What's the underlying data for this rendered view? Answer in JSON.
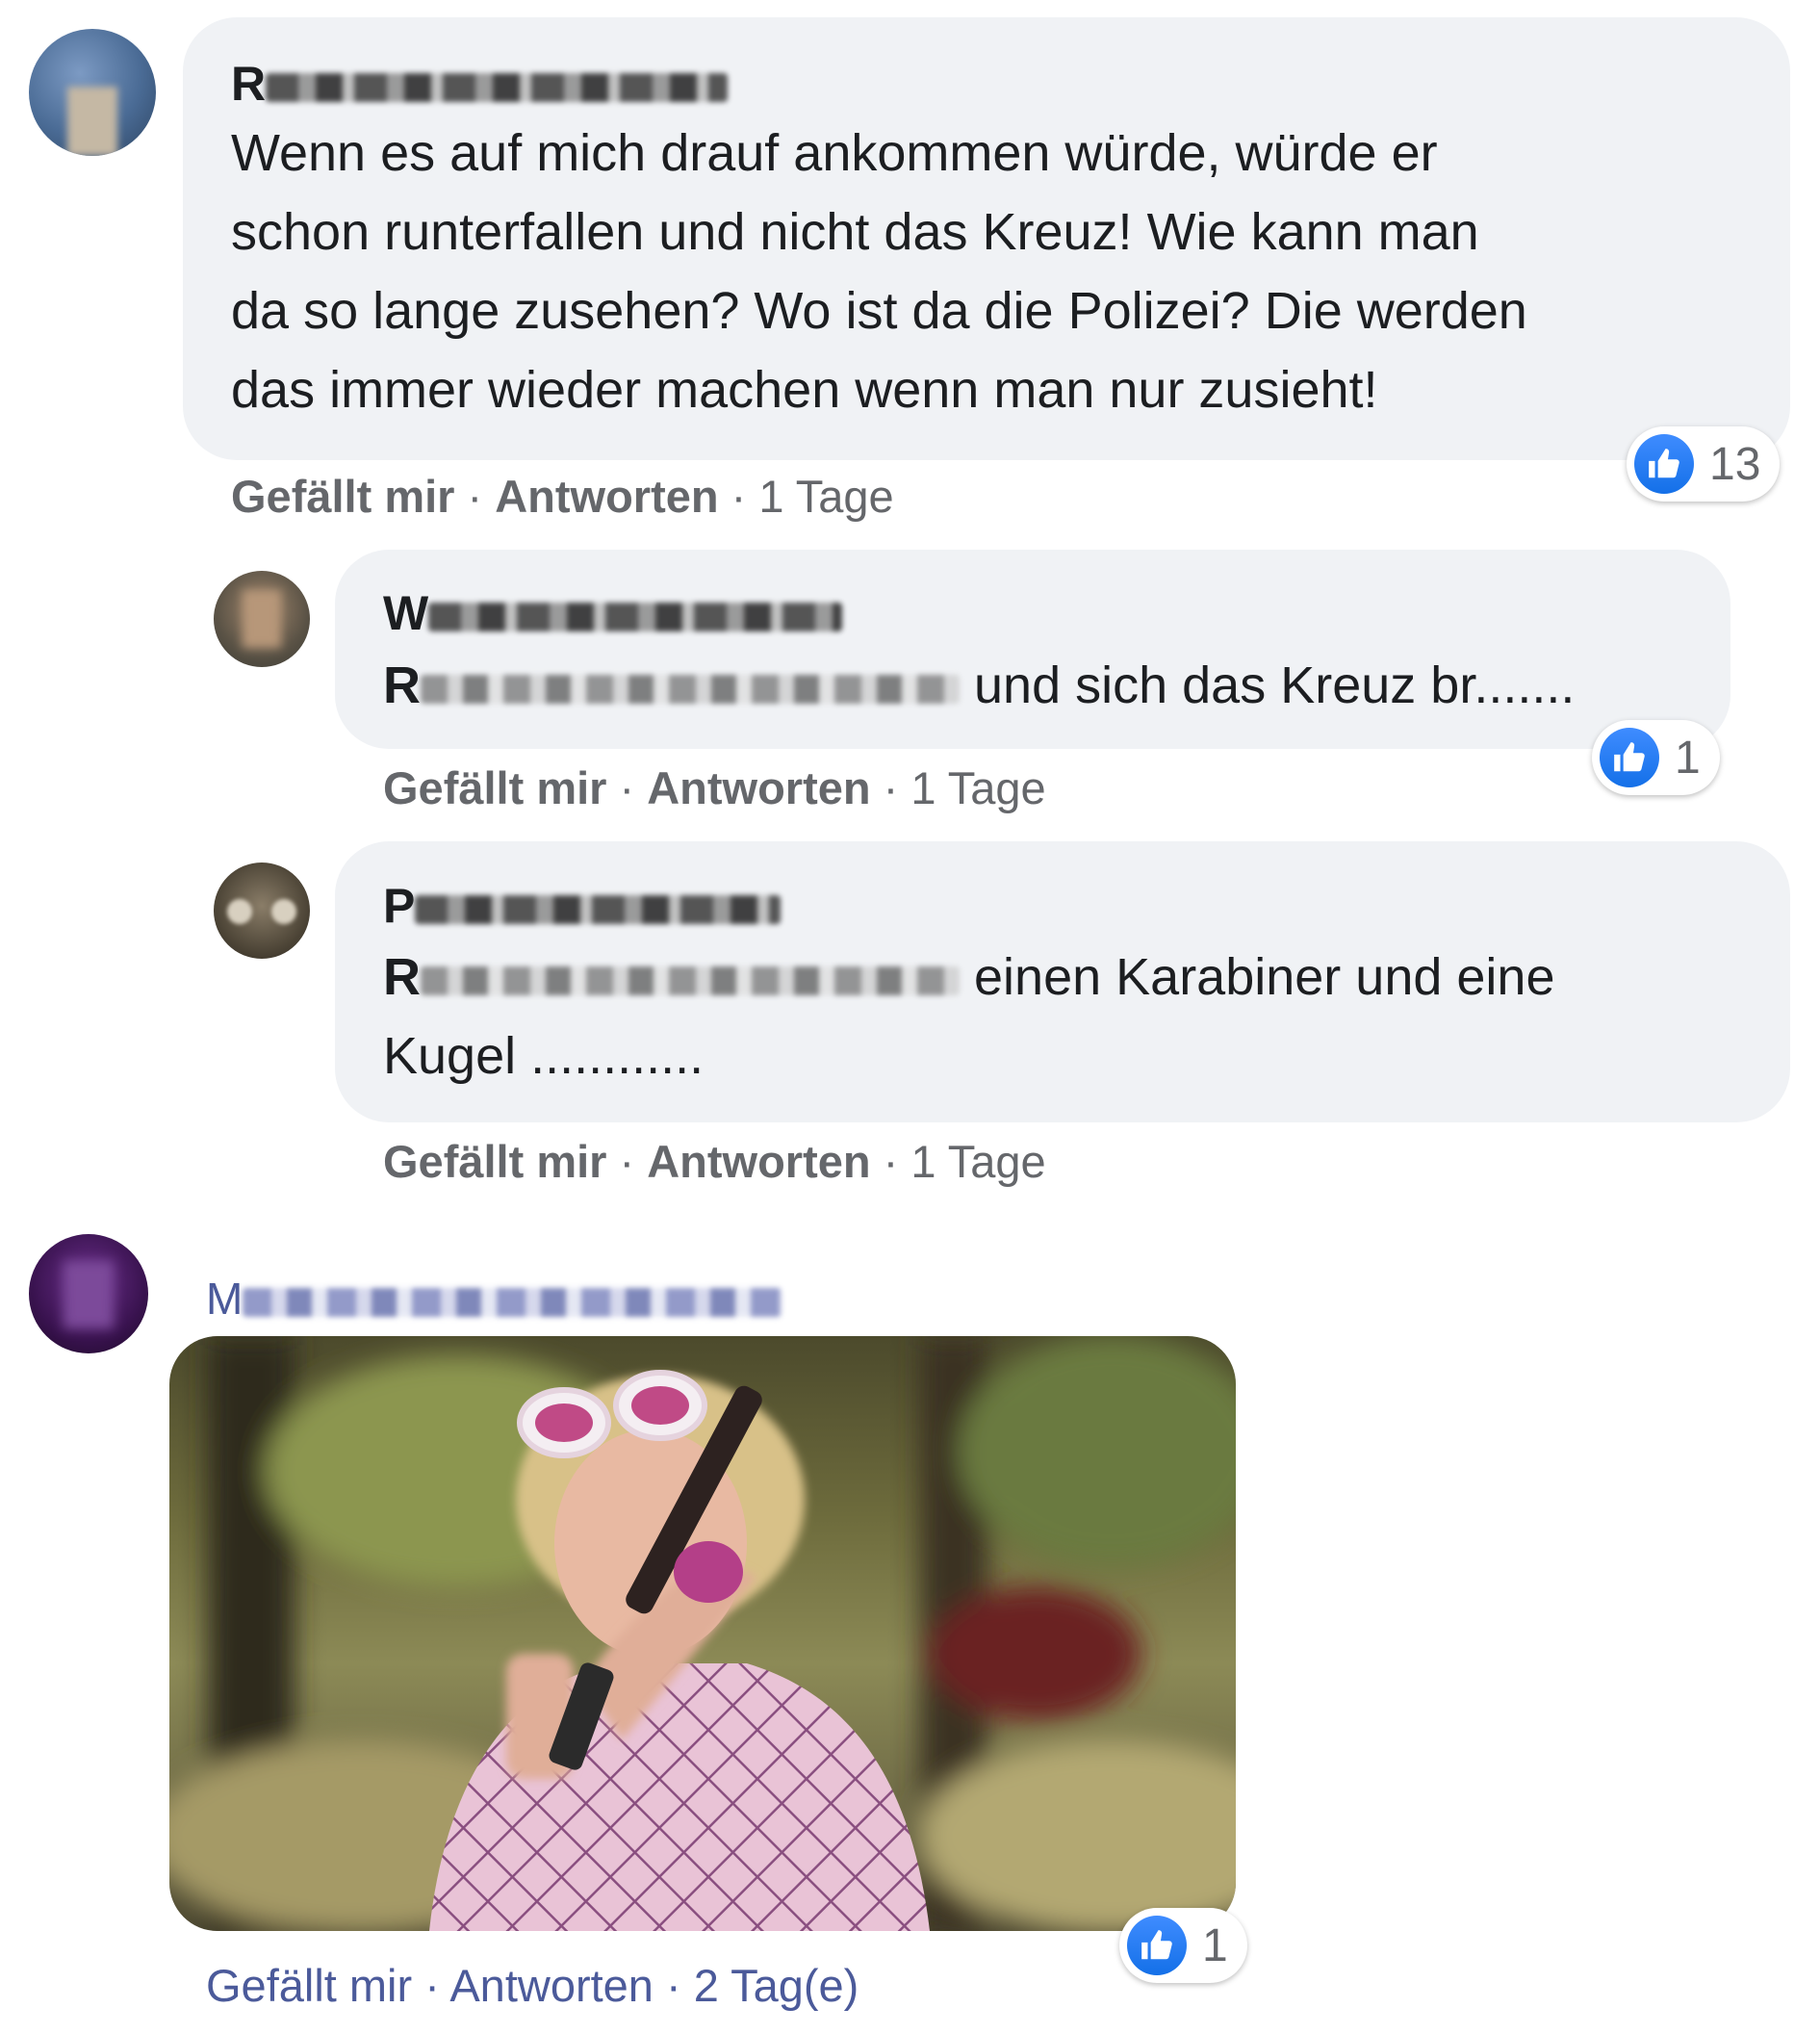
{
  "comments": [
    {
      "author": "R",
      "text": "Wenn es auf mich drauf ankommen würde, würde er schon runterfallen und nicht das Kreuz! Wie kann man da so lange zusehen? Wo ist da die Polizei? Die werden das immer wieder machen wenn man nur zusieht!",
      "lines": [
        "Wenn es auf mich drauf ankommen würde, würde er",
        "schon runterfallen und nicht das Kreuz! Wie kann man",
        "da so lange zusehen? Wo ist da die Polizei? Die werden",
        "das immer wieder machen wenn man nur zusieht!"
      ],
      "reactions": "13",
      "like_label": "Gefällt mir",
      "reply_label": "Antworten",
      "time": "1 Tage"
    },
    {
      "author": "W",
      "mention": "R",
      "text": "und sich das Kreuz br.......",
      "reactions": "1",
      "like_label": "Gefällt mir",
      "reply_label": "Antworten",
      "time": "1 Tage"
    },
    {
      "author": "P",
      "mention": "R",
      "text_line1": "einen Karabiner und eine",
      "text_line2": "Kugel ............",
      "reactions": "1",
      "like_label": "Gefällt mir",
      "reply_label": "Antworten",
      "time": "1 Tage"
    },
    {
      "author": "M",
      "media": "GIF image: woman in pink outfit and heart-shaped sunglasses aiming a pistol outdoors",
      "reactions": "1",
      "like_label": "Gefällt mir",
      "reply_label": "Antworten",
      "time": "2 Tag(e)"
    }
  ],
  "separator": "·",
  "icons": {
    "reaction": "like-icon"
  },
  "colors": {
    "bubble": "#f0f2f5",
    "like_blue": "#1877f2",
    "meta_gray": "#65676b",
    "meta_blue": "#4b5a9a"
  }
}
